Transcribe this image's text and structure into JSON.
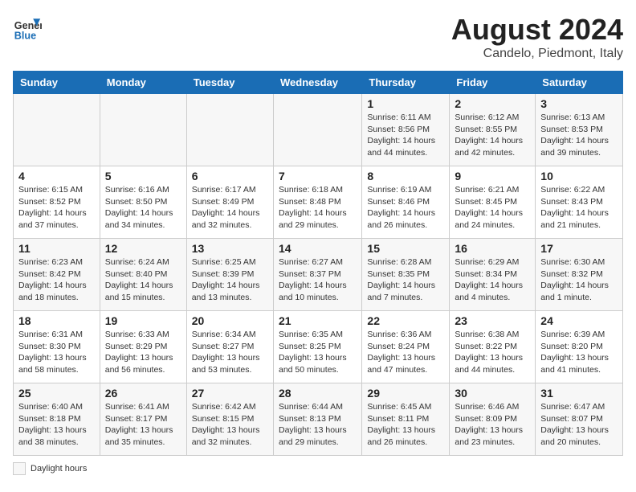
{
  "header": {
    "logo_line1": "General",
    "logo_line2": "Blue",
    "month_title": "August 2024",
    "location": "Candelo, Piedmont, Italy"
  },
  "days_of_week": [
    "Sunday",
    "Monday",
    "Tuesday",
    "Wednesday",
    "Thursday",
    "Friday",
    "Saturday"
  ],
  "weeks": [
    [
      {
        "num": "",
        "info": ""
      },
      {
        "num": "",
        "info": ""
      },
      {
        "num": "",
        "info": ""
      },
      {
        "num": "",
        "info": ""
      },
      {
        "num": "1",
        "info": "Sunrise: 6:11 AM\nSunset: 8:56 PM\nDaylight: 14 hours and 44 minutes."
      },
      {
        "num": "2",
        "info": "Sunrise: 6:12 AM\nSunset: 8:55 PM\nDaylight: 14 hours and 42 minutes."
      },
      {
        "num": "3",
        "info": "Sunrise: 6:13 AM\nSunset: 8:53 PM\nDaylight: 14 hours and 39 minutes."
      }
    ],
    [
      {
        "num": "4",
        "info": "Sunrise: 6:15 AM\nSunset: 8:52 PM\nDaylight: 14 hours and 37 minutes."
      },
      {
        "num": "5",
        "info": "Sunrise: 6:16 AM\nSunset: 8:50 PM\nDaylight: 14 hours and 34 minutes."
      },
      {
        "num": "6",
        "info": "Sunrise: 6:17 AM\nSunset: 8:49 PM\nDaylight: 14 hours and 32 minutes."
      },
      {
        "num": "7",
        "info": "Sunrise: 6:18 AM\nSunset: 8:48 PM\nDaylight: 14 hours and 29 minutes."
      },
      {
        "num": "8",
        "info": "Sunrise: 6:19 AM\nSunset: 8:46 PM\nDaylight: 14 hours and 26 minutes."
      },
      {
        "num": "9",
        "info": "Sunrise: 6:21 AM\nSunset: 8:45 PM\nDaylight: 14 hours and 24 minutes."
      },
      {
        "num": "10",
        "info": "Sunrise: 6:22 AM\nSunset: 8:43 PM\nDaylight: 14 hours and 21 minutes."
      }
    ],
    [
      {
        "num": "11",
        "info": "Sunrise: 6:23 AM\nSunset: 8:42 PM\nDaylight: 14 hours and 18 minutes."
      },
      {
        "num": "12",
        "info": "Sunrise: 6:24 AM\nSunset: 8:40 PM\nDaylight: 14 hours and 15 minutes."
      },
      {
        "num": "13",
        "info": "Sunrise: 6:25 AM\nSunset: 8:39 PM\nDaylight: 14 hours and 13 minutes."
      },
      {
        "num": "14",
        "info": "Sunrise: 6:27 AM\nSunset: 8:37 PM\nDaylight: 14 hours and 10 minutes."
      },
      {
        "num": "15",
        "info": "Sunrise: 6:28 AM\nSunset: 8:35 PM\nDaylight: 14 hours and 7 minutes."
      },
      {
        "num": "16",
        "info": "Sunrise: 6:29 AM\nSunset: 8:34 PM\nDaylight: 14 hours and 4 minutes."
      },
      {
        "num": "17",
        "info": "Sunrise: 6:30 AM\nSunset: 8:32 PM\nDaylight: 14 hours and 1 minute."
      }
    ],
    [
      {
        "num": "18",
        "info": "Sunrise: 6:31 AM\nSunset: 8:30 PM\nDaylight: 13 hours and 58 minutes."
      },
      {
        "num": "19",
        "info": "Sunrise: 6:33 AM\nSunset: 8:29 PM\nDaylight: 13 hours and 56 minutes."
      },
      {
        "num": "20",
        "info": "Sunrise: 6:34 AM\nSunset: 8:27 PM\nDaylight: 13 hours and 53 minutes."
      },
      {
        "num": "21",
        "info": "Sunrise: 6:35 AM\nSunset: 8:25 PM\nDaylight: 13 hours and 50 minutes."
      },
      {
        "num": "22",
        "info": "Sunrise: 6:36 AM\nSunset: 8:24 PM\nDaylight: 13 hours and 47 minutes."
      },
      {
        "num": "23",
        "info": "Sunrise: 6:38 AM\nSunset: 8:22 PM\nDaylight: 13 hours and 44 minutes."
      },
      {
        "num": "24",
        "info": "Sunrise: 6:39 AM\nSunset: 8:20 PM\nDaylight: 13 hours and 41 minutes."
      }
    ],
    [
      {
        "num": "25",
        "info": "Sunrise: 6:40 AM\nSunset: 8:18 PM\nDaylight: 13 hours and 38 minutes."
      },
      {
        "num": "26",
        "info": "Sunrise: 6:41 AM\nSunset: 8:17 PM\nDaylight: 13 hours and 35 minutes."
      },
      {
        "num": "27",
        "info": "Sunrise: 6:42 AM\nSunset: 8:15 PM\nDaylight: 13 hours and 32 minutes."
      },
      {
        "num": "28",
        "info": "Sunrise: 6:44 AM\nSunset: 8:13 PM\nDaylight: 13 hours and 29 minutes."
      },
      {
        "num": "29",
        "info": "Sunrise: 6:45 AM\nSunset: 8:11 PM\nDaylight: 13 hours and 26 minutes."
      },
      {
        "num": "30",
        "info": "Sunrise: 6:46 AM\nSunset: 8:09 PM\nDaylight: 13 hours and 23 minutes."
      },
      {
        "num": "31",
        "info": "Sunrise: 6:47 AM\nSunset: 8:07 PM\nDaylight: 13 hours and 20 minutes."
      }
    ]
  ],
  "legend": {
    "daylight_label": "Daylight hours"
  }
}
